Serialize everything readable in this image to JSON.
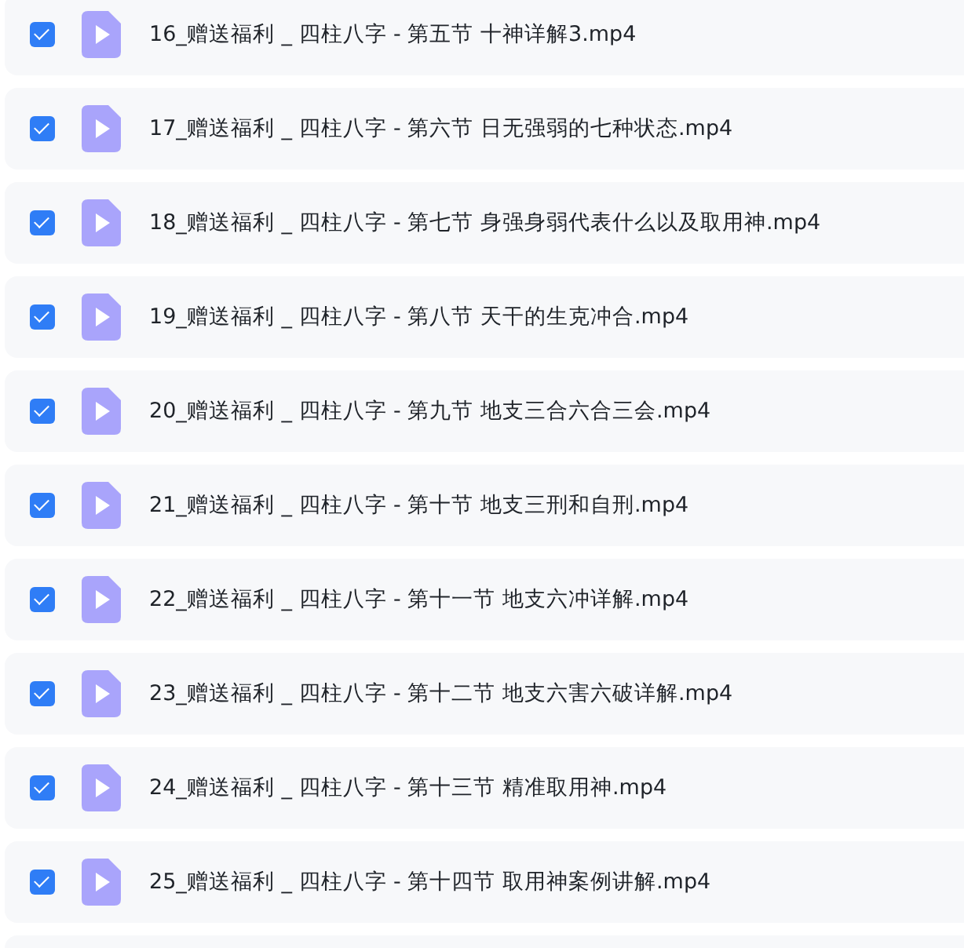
{
  "files": [
    {
      "name": "16_赠送福利 _ 四柱八字 - 第五节 十神详解3.mp4",
      "checked": true
    },
    {
      "name": "17_赠送福利 _ 四柱八字 - 第六节 日无强弱的七种状态.mp4",
      "checked": true
    },
    {
      "name": "18_赠送福利 _ 四柱八字 - 第七节 身强身弱代表什么以及取用神.mp4",
      "checked": true
    },
    {
      "name": "19_赠送福利 _ 四柱八字 - 第八节 天干的生克冲合.mp4",
      "checked": true
    },
    {
      "name": "20_赠送福利 _ 四柱八字 - 第九节 地支三合六合三会.mp4",
      "checked": true
    },
    {
      "name": "21_赠送福利 _ 四柱八字 - 第十节 地支三刑和自刑.mp4",
      "checked": true
    },
    {
      "name": "22_赠送福利 _ 四柱八字 - 第十一节 地支六冲详解.mp4",
      "checked": true
    },
    {
      "name": "23_赠送福利 _ 四柱八字 - 第十二节 地支六害六破详解.mp4",
      "checked": true
    },
    {
      "name": "24_赠送福利 _ 四柱八字 - 第十三节 精准取用神.mp4",
      "checked": true
    },
    {
      "name": "25_赠送福利 _ 四柱八字 - 第十四节 取用神案例讲解.mp4",
      "checked": true
    }
  ]
}
